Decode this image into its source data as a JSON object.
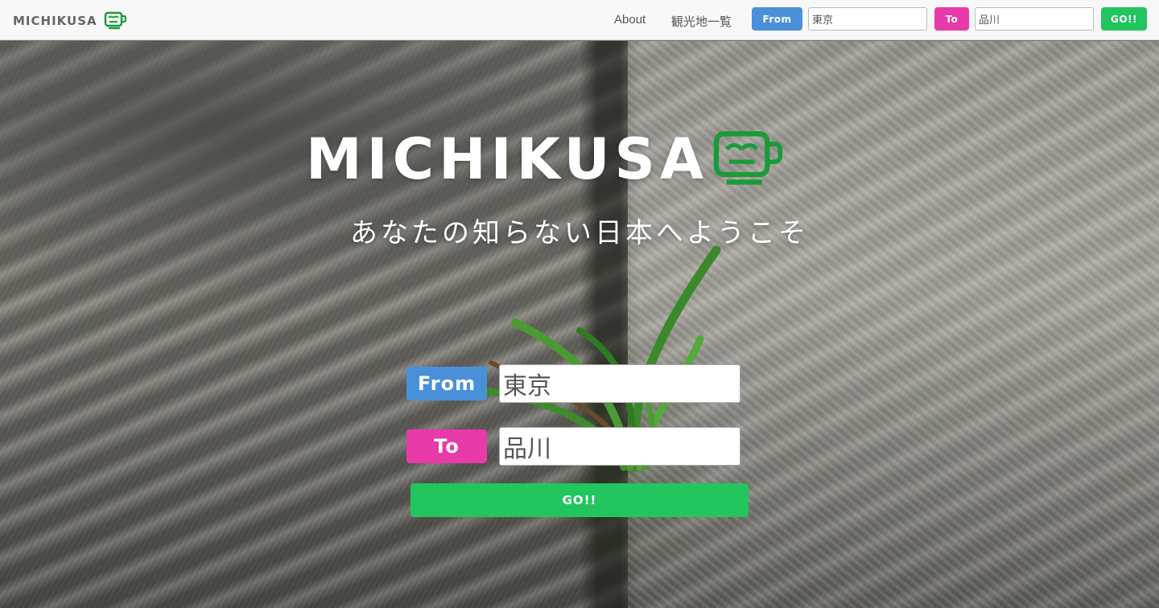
{
  "navbar": {
    "brand": "MICHIKUSA",
    "links": [
      "About",
      "観光地一覧"
    ],
    "from_label": "From",
    "from_value": "東京",
    "to_label": "To",
    "to_value": "品川",
    "go_label": "GO!!"
  },
  "hero": {
    "title": "MICHIKUSA",
    "tagline": "あなたの知らない日本へようこそ",
    "from_label": "From",
    "from_value": "東京",
    "to_label": "To",
    "to_value": "品川",
    "go_label": "GO!!"
  },
  "colors": {
    "from": "#4a90d9",
    "to": "#e83aa8",
    "go": "#22c55e",
    "logo_icon": "#1a9b3a"
  },
  "icons": {
    "logo": "cup-face-icon"
  }
}
